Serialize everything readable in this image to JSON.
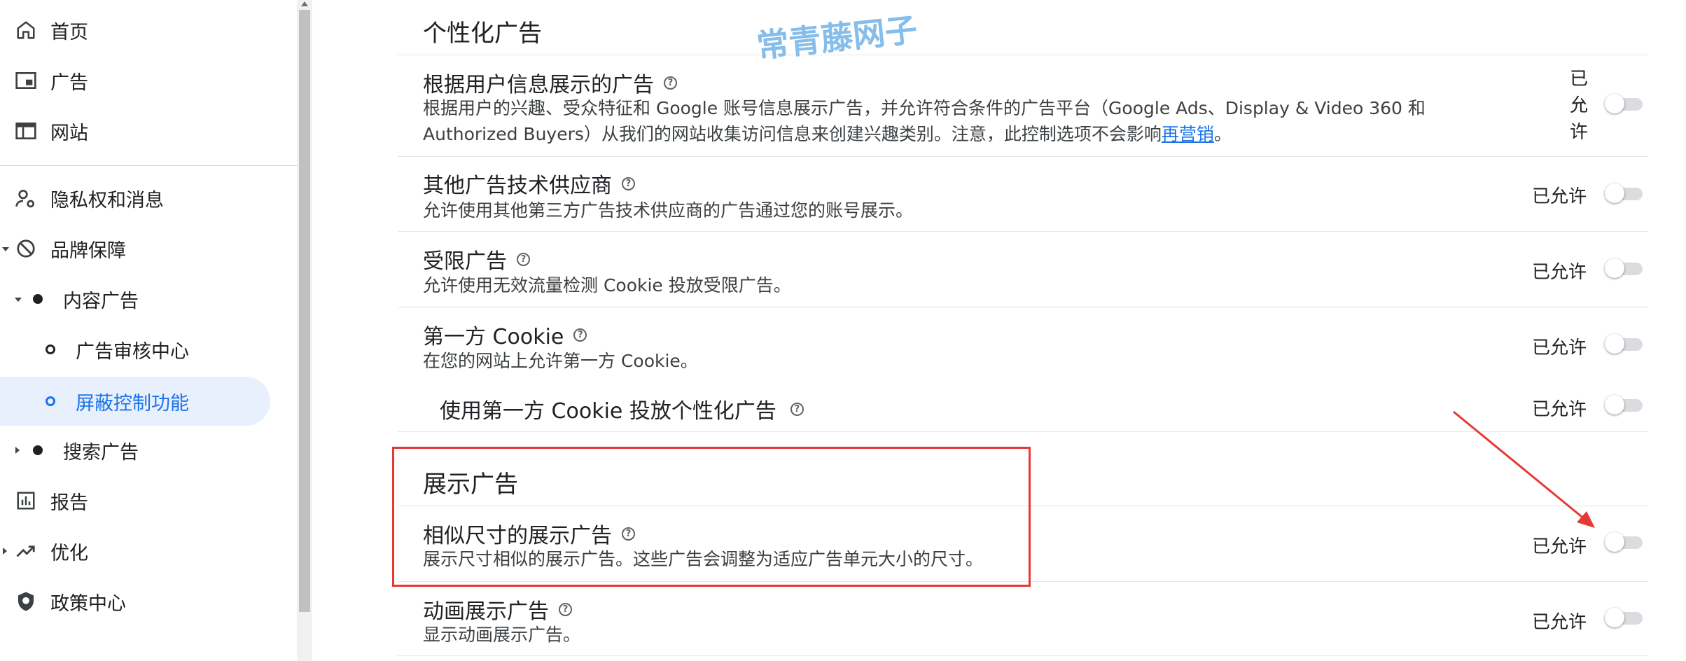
{
  "sidebar": {
    "items": [
      {
        "label": "首页",
        "icon": "home-icon"
      },
      {
        "label": "广告",
        "icon": "ad-units-icon"
      },
      {
        "label": "网站",
        "icon": "web-icon"
      },
      {
        "label": "隐私权和消息",
        "icon": "person-privacy-icon"
      },
      {
        "label": "品牌保障",
        "icon": "block-icon"
      },
      {
        "label": "内容广告"
      },
      {
        "label": "广告审核中心"
      },
      {
        "label": "屏蔽控制功能"
      },
      {
        "label": "搜索广告"
      },
      {
        "label": "报告",
        "icon": "bar-chart-icon"
      },
      {
        "label": "优化",
        "icon": "trending-up-icon"
      },
      {
        "label": "政策中心",
        "icon": "shield-icon"
      }
    ]
  },
  "main": {
    "watermark": "常青藤网子",
    "sections": [
      {
        "title": "个性化广告",
        "rows": [
          {
            "title": "根据用户信息展示的广告",
            "desc_before": "根据用户的兴趣、受众特征和 Google 账号信息展示广告，并允许符合条件的广告平台（Google Ads、Display & Video 360 和 Authorized Buyers）从我们的网站收集访问信息来创建兴趣类别。注意，此控制选项不会影响",
            "desc_link": "再营销",
            "desc_after": "。",
            "status": "已允许"
          },
          {
            "title": "其他广告技术供应商",
            "desc": "允许使用其他第三方广告技术供应商的广告通过您的账号展示。",
            "status": "已允许"
          },
          {
            "title": "受限广告",
            "desc": "允许使用无效流量检测 Cookie 投放受限广告。",
            "status": "已允许"
          },
          {
            "title": "第一方 Cookie",
            "desc": "在您的网站上允许第一方 Cookie。",
            "status": "已允许"
          },
          {
            "title": "使用第一方 Cookie 投放个性化广告",
            "status": "已允许"
          }
        ]
      },
      {
        "title": "展示广告",
        "rows": [
          {
            "title": "相似尺寸的展示广告",
            "desc": "展示尺寸相似的展示广告。这些广告会调整为适应广告单元大小的尺寸。",
            "status": "已允许"
          },
          {
            "title": "动画展示广告",
            "desc": "显示动画展示广告。",
            "status": "已允许"
          }
        ]
      }
    ]
  },
  "colors": {
    "accent": "#1a73e8",
    "active_bg": "#e8f0fe",
    "highlight": "#e53935",
    "toggle_track": "#dadce0"
  }
}
